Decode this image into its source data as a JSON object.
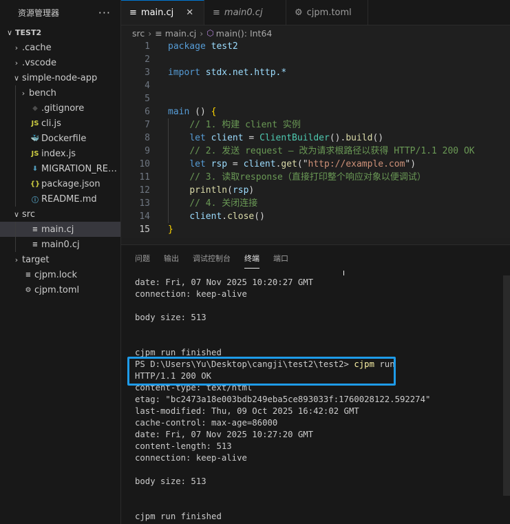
{
  "sidebar": {
    "title": "资源管理器",
    "more": "···",
    "items": [
      {
        "label": "TEST2",
        "chev": "∨",
        "icon": "",
        "depth": 0,
        "bold": true
      },
      {
        "label": ".cache",
        "chev": "›",
        "icon": "",
        "depth": 1
      },
      {
        "label": ".vscode",
        "chev": "›",
        "icon": "",
        "depth": 1
      },
      {
        "label": "simple-node-app",
        "chev": "∨",
        "icon": "",
        "depth": 1
      },
      {
        "label": "bench",
        "chev": "›",
        "icon": "",
        "depth": 2
      },
      {
        "label": ".gitignore",
        "chev": "",
        "icon": "◆",
        "icon_color": "#4d4d4d",
        "depth": 2
      },
      {
        "label": "cli.js",
        "chev": "",
        "icon": "JS",
        "icon_color": "#cbcb41",
        "depth": 2
      },
      {
        "label": "Dockerfile",
        "chev": "",
        "icon": "🐳",
        "icon_color": "#519aba",
        "depth": 2
      },
      {
        "label": "index.js",
        "chev": "",
        "icon": "JS",
        "icon_color": "#cbcb41",
        "depth": 2
      },
      {
        "label": "MIGRATION_REPOR...",
        "chev": "",
        "icon": "⬇",
        "icon_color": "#519aba",
        "depth": 2
      },
      {
        "label": "package.json",
        "chev": "",
        "icon": "{}",
        "icon_color": "#cbcb41",
        "depth": 2
      },
      {
        "label": "README.md",
        "chev": "",
        "icon": "ⓘ",
        "icon_color": "#519aba",
        "depth": 2
      },
      {
        "label": "src",
        "chev": "∨",
        "icon": "",
        "depth": 1
      },
      {
        "label": "main.cj",
        "chev": "",
        "icon": "≡",
        "icon_color": "#cccccc",
        "depth": 2,
        "selected": true
      },
      {
        "label": "main0.cj",
        "chev": "",
        "icon": "≡",
        "icon_color": "#cccccc",
        "depth": 2
      },
      {
        "label": "target",
        "chev": "›",
        "icon": "",
        "depth": 1
      },
      {
        "label": "cjpm.lock",
        "chev": "",
        "icon": "≡",
        "icon_color": "#cccccc",
        "depth": 1
      },
      {
        "label": "cjpm.toml",
        "chev": "",
        "icon": "⚙",
        "icon_color": "#cccccc",
        "depth": 1
      }
    ]
  },
  "tabs": [
    {
      "label": "main.cj",
      "icon": "≡",
      "active": true,
      "close": "✕"
    },
    {
      "label": "main0.cj",
      "icon": "≡",
      "active": false,
      "italic": true
    },
    {
      "label": "cjpm.toml",
      "icon": "⚙",
      "active": false
    }
  ],
  "breadcrumb": {
    "root": "src",
    "file": "main.cj",
    "symbol": "main(): Int64"
  },
  "editor": {
    "current_line": 15,
    "lines": [
      [
        {
          "t": "package ",
          "c": "kw"
        },
        {
          "t": "test2",
          "c": "var"
        }
      ],
      [],
      [
        {
          "t": "import ",
          "c": "kw"
        },
        {
          "t": "stdx.net.http.*",
          "c": "var"
        }
      ],
      [],
      [],
      [
        {
          "t": "main",
          "c": "kw"
        },
        {
          "t": " () ",
          "c": "paren"
        },
        {
          "t": "{",
          "c": "brk"
        }
      ],
      [
        {
          "t": "    "
        },
        {
          "t": "// 1. 构建 client 实例",
          "c": "com"
        }
      ],
      [
        {
          "t": "    "
        },
        {
          "t": "let ",
          "c": "kw"
        },
        {
          "t": "client",
          "c": "var"
        },
        {
          "t": " = ",
          "c": "paren"
        },
        {
          "t": "ClientBuilder",
          "c": "ty"
        },
        {
          "t": "().",
          "c": "paren"
        },
        {
          "t": "build",
          "c": "fn"
        },
        {
          "t": "()",
          "c": "paren"
        }
      ],
      [
        {
          "t": "    "
        },
        {
          "t": "// 2. 发送 request — 改为请求根路径以获得 HTTP/1.1 200 OK",
          "c": "com"
        }
      ],
      [
        {
          "t": "    "
        },
        {
          "t": "let ",
          "c": "kw"
        },
        {
          "t": "rsp",
          "c": "var"
        },
        {
          "t": " = ",
          "c": "paren"
        },
        {
          "t": "client",
          "c": "var"
        },
        {
          "t": ".",
          "c": "paren"
        },
        {
          "t": "get",
          "c": "fn"
        },
        {
          "t": "(\"",
          "c": "paren"
        },
        {
          "t": "http://example.com",
          "c": "str"
        },
        {
          "t": "\")",
          "c": "paren"
        }
      ],
      [
        {
          "t": "    "
        },
        {
          "t": "// 3. 读取response（直接打印整个响应对象以便调试）",
          "c": "com"
        }
      ],
      [
        {
          "t": "    "
        },
        {
          "t": "println",
          "c": "fn"
        },
        {
          "t": "(",
          "c": "paren"
        },
        {
          "t": "rsp",
          "c": "var"
        },
        {
          "t": ")",
          "c": "paren"
        }
      ],
      [
        {
          "t": "    "
        },
        {
          "t": "// 4. 关闭连接",
          "c": "com"
        }
      ],
      [
        {
          "t": "    "
        },
        {
          "t": "client",
          "c": "var"
        },
        {
          "t": ".",
          "c": "paren"
        },
        {
          "t": "close",
          "c": "fn"
        },
        {
          "t": "()",
          "c": "paren"
        }
      ],
      [
        {
          "t": "}",
          "c": "brk"
        }
      ]
    ]
  },
  "panel": {
    "tabs": [
      {
        "label": "问题",
        "active": false
      },
      {
        "label": "输出",
        "active": false
      },
      {
        "label": "调试控制台",
        "active": false
      },
      {
        "label": "终端",
        "active": true
      },
      {
        "label": "端口",
        "active": false
      }
    ],
    "terminal_lines": [
      "date: Fri, 07 Nov 2025 10:20:27 GMT",
      "connection: keep-alive",
      "",
      "body size: 513",
      "",
      "",
      "cjpm run finished",
      "PS D:\\Users\\Yu\\Desktop\\cangji\\test2\\test2> ",
      "HTTP/1.1 200 OK",
      "content-type: text/html",
      "etag: \"bc2473a18e003bdb249eba5ce893033f:1760028122.592274\"",
      "last-modified: Thu, 09 Oct 2025 16:42:02 GMT",
      "cache-control: max-age=86000",
      "date: Fri, 07 Nov 2025 10:27:20 GMT",
      "content-length: 513",
      "connection: keep-alive",
      "",
      "body size: 513",
      "",
      "",
      "cjpm run finished"
    ],
    "prompt_command": "cjpm",
    "prompt_args": " run"
  },
  "colors": {
    "accent": "#0078d4",
    "highlight_box": "#1e9be9"
  }
}
